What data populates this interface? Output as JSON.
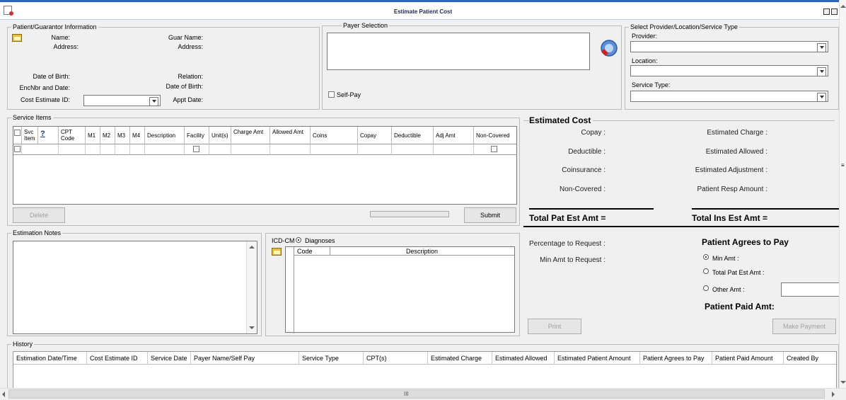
{
  "window": {
    "title": "Estimate Patient Cost"
  },
  "patient": {
    "group_label": "Patient/Guarantor Information",
    "name_label": "Name:",
    "address_label": "Address:",
    "guar_name_label": "Guar Name:",
    "guar_address_label": "Address:",
    "dob_label": "Date of Birth:",
    "relation_label": "Relation:",
    "enc_label": "EncNbr and Date:",
    "guar_dob_label": "Date of Birth:",
    "cost_estimate_label": "Cost Estimate ID:",
    "appt_date_label": "Appt Date:"
  },
  "payer": {
    "group_label": "Payer Selection",
    "self_pay_label": "Self-Pay"
  },
  "provider": {
    "group_label": "Select Provider/Location/Service Type",
    "provider_label": "Provider:",
    "location_label": "Location:",
    "service_type_label": "Service Type:"
  },
  "service_items": {
    "group_label": "Service Items",
    "columns": [
      "Svc Item",
      "?",
      "CPT Code",
      "M1",
      "M2",
      "M3",
      "M4",
      "Description",
      "Facility",
      "Unit(s)",
      "Charge Amt",
      "Allowed Amt",
      "Coins",
      "Copay",
      "Deductible",
      "Adj Amt",
      "Non-Covered"
    ],
    "delete_label": "Delete",
    "submit_label": "Submit"
  },
  "notes": {
    "group_label": "Estimation Notes"
  },
  "icd": {
    "label": "ICD-CM",
    "diagnoses_label": "Diagnoses",
    "code_header": "Code",
    "description_header": "Description"
  },
  "estimated_cost": {
    "title": "Estimated Cost",
    "copay": "Copay :",
    "deductible": "Deductible :",
    "coinsurance": "Coinsurance :",
    "non_covered": "Non-Covered :",
    "estimated_charge": "Estimated Charge :",
    "estimated_allowed": "Estimated Allowed :",
    "estimated_adjustment": "Estimated Adjustment :",
    "patient_resp": "Patient Resp Amount :",
    "total_pat": "Total Pat Est Amt =",
    "total_ins": "Total Ins Est Amt =",
    "percentage": "Percentage to Request :",
    "min_amt_request": "Min Amt to Request :",
    "agrees_title": "Patient Agrees to Pay",
    "opt_min": "Min Amt :",
    "opt_total": "Total Pat Est Amt :",
    "opt_other": "Other Amt :",
    "paid_title": "Patient Paid Amt:",
    "print_label": "Print",
    "make_payment_label": "Make Payment"
  },
  "history": {
    "group_label": "History",
    "columns": [
      "Estimation Date/Time",
      "Cost Estimate ID",
      "Service Date",
      "Payer Name/Self Pay",
      "Service Type",
      "CPT(s)",
      "Estimated Charge",
      "Estimated Allowed",
      "Estimated Patient Amount",
      "Patient Agrees to Pay",
      "Patient Paid Amount",
      "Created By"
    ]
  },
  "scrollbar": {
    "thumb_glyph": "III"
  }
}
